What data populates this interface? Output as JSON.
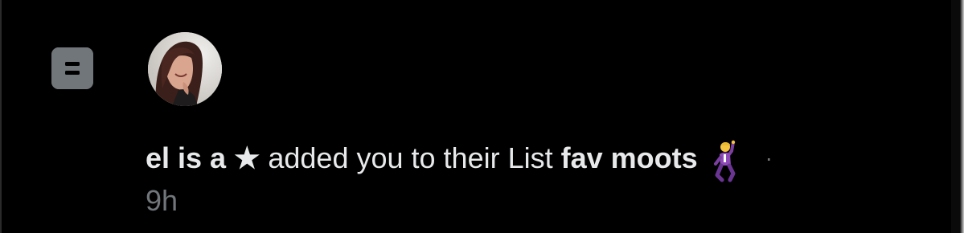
{
  "notification": {
    "type_icon": "list-icon",
    "avatar": "user-avatar-photo",
    "actor_name": "el is a ★",
    "action_text": "added you to their List",
    "list_name": "fav moots",
    "emoji": "man-dancing-emoji",
    "separator": "·",
    "timestamp": "9h"
  },
  "colors": {
    "background": "#000000",
    "primary_text": "#e7e9ea",
    "secondary_text": "#71767b",
    "list_icon_bg": "#71767b"
  }
}
